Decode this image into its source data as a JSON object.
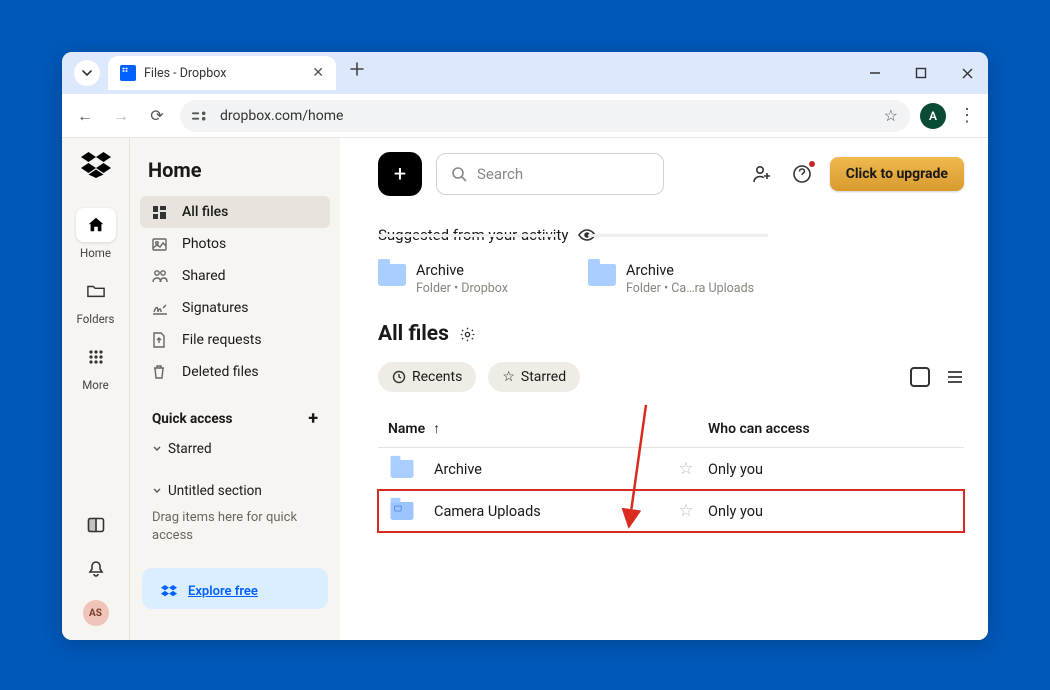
{
  "browser": {
    "tab_title": "Files - Dropbox",
    "url": "dropbox.com/home",
    "profile_initial": "A"
  },
  "rail": {
    "items": [
      {
        "label": "Home"
      },
      {
        "label": "Folders"
      },
      {
        "label": "More"
      }
    ],
    "avatar_initials": "AS"
  },
  "sidebar": {
    "title": "Home",
    "nav": [
      {
        "label": "All files"
      },
      {
        "label": "Photos"
      },
      {
        "label": "Shared"
      },
      {
        "label": "Signatures"
      },
      {
        "label": "File requests"
      },
      {
        "label": "Deleted files"
      }
    ],
    "quick_access_label": "Quick access",
    "starred_label": "Starred",
    "untitled_label": "Untitled section",
    "hint": "Drag items here for quick access",
    "promo": "Explore free"
  },
  "main": {
    "search_placeholder": "Search",
    "upgrade_label": "Click to upgrade",
    "suggested_label": "Suggested from your activity",
    "suggestions": [
      {
        "title": "Archive",
        "subtitle": "Folder • Dropbox"
      },
      {
        "title": "Archive",
        "subtitle": "Folder • Ca…ra Uploads"
      }
    ],
    "all_files_heading": "All files",
    "chips": {
      "recents": "Recents",
      "starred": "Starred"
    },
    "columns": {
      "name": "Name",
      "access": "Who can access"
    },
    "rows": [
      {
        "name": "Archive",
        "access": "Only you"
      },
      {
        "name": "Camera Uploads",
        "access": "Only you"
      }
    ]
  }
}
